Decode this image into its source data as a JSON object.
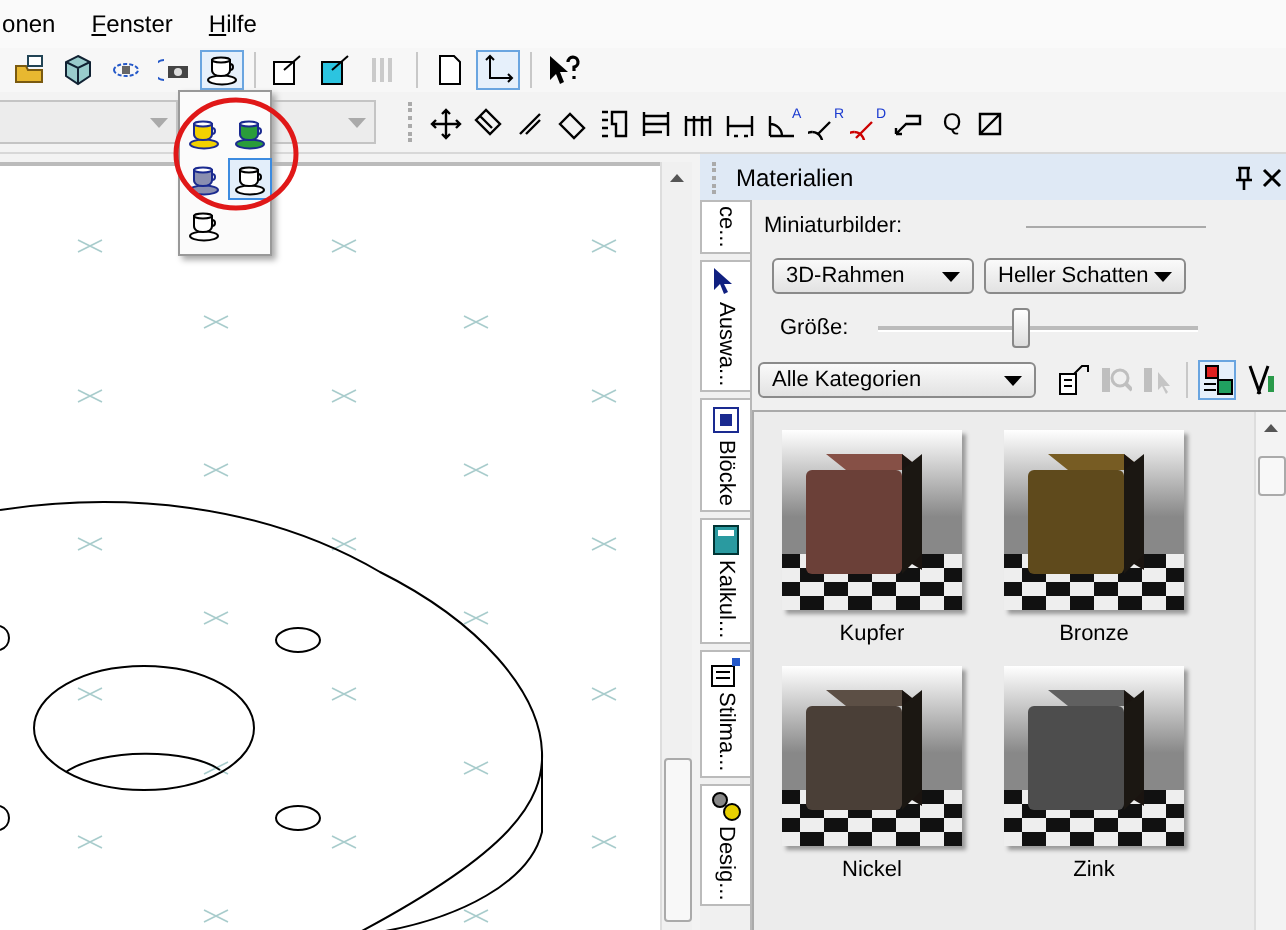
{
  "menu": [
    {
      "label": "onen",
      "accelerator": false
    },
    {
      "label": "Fenster",
      "accelerator": true
    },
    {
      "label": "Hilfe",
      "accelerator": true
    }
  ],
  "toolbar": [
    {
      "kind": "open",
      "pressed": false,
      "disabled": false
    },
    {
      "kind": "cube",
      "pressed": false,
      "disabled": false
    },
    {
      "kind": "orbit",
      "pressed": false,
      "disabled": false
    },
    {
      "kind": "camera",
      "pressed": false,
      "disabled": false
    },
    {
      "kind": "render",
      "pressed": true,
      "disabled": false
    },
    {
      "kind": "separator"
    },
    {
      "kind": "export",
      "pressed": false,
      "disabled": false
    },
    {
      "kind": "export-color",
      "pressed": false,
      "disabled": false
    },
    {
      "kind": "bars",
      "pressed": false,
      "disabled": true
    },
    {
      "kind": "separator"
    },
    {
      "kind": "page",
      "pressed": false,
      "disabled": false
    },
    {
      "kind": "axes",
      "pressed": true,
      "disabled": false
    },
    {
      "kind": "separator"
    },
    {
      "kind": "help",
      "pressed": false,
      "disabled": false
    }
  ],
  "combo_boxes": [
    {
      "disabled": true
    },
    {
      "disabled": true
    }
  ],
  "dimension_tools": [
    {
      "kind": "move"
    },
    {
      "kind": "aligned"
    },
    {
      "kind": "slant"
    },
    {
      "kind": "rotated"
    },
    {
      "kind": "ordinate"
    },
    {
      "kind": "baseline"
    },
    {
      "kind": "continuous"
    },
    {
      "kind": "chain"
    },
    {
      "kind": "angle",
      "mark": "A"
    },
    {
      "kind": "radius",
      "mark": "R"
    },
    {
      "kind": "diameter",
      "mark": "D"
    },
    {
      "kind": "leader"
    },
    {
      "kind": "letter",
      "mark": "Q"
    },
    {
      "kind": "datum"
    }
  ],
  "render_menu": [
    {
      "kind": "gold",
      "selected": false
    },
    {
      "kind": "rainbow",
      "selected": false
    },
    {
      "kind": "grey",
      "selected": false
    },
    {
      "kind": "outline",
      "selected": true
    },
    {
      "kind": "outline",
      "selected": false
    }
  ],
  "panel": {
    "title": "Materialien",
    "tabs": [
      {
        "label": "ce...",
        "kind": "none"
      },
      {
        "label": "Auswa...",
        "kind": "select"
      },
      {
        "label": "Blöcke",
        "kind": "blocks"
      },
      {
        "label": "Kalkul...",
        "kind": "calculator"
      },
      {
        "label": "Stilma...",
        "kind": "styles"
      },
      {
        "label": "Desig...",
        "kind": "design"
      }
    ],
    "thumbnails_label": "Miniaturbilder:",
    "frame_select": "3D-Rahmen",
    "shadow_select": "Heller Schatten",
    "size_label": "Größe:",
    "size_slider": {
      "level": 0.44
    },
    "category_select": "Alle Kategorien",
    "category_tools": [
      {
        "kind": "properties",
        "disabled": false,
        "pressed": false
      },
      {
        "kind": "find",
        "disabled": true,
        "pressed": false
      },
      {
        "kind": "pick",
        "disabled": true,
        "pressed": false
      },
      {
        "kind": "view",
        "disabled": false,
        "pressed": true
      },
      {
        "kind": "tools",
        "disabled": false,
        "pressed": false
      }
    ],
    "materials": [
      {
        "name": "Kupfer",
        "color": "#6b4038"
      },
      {
        "name": "Bronze",
        "color": "#5f4a1c"
      },
      {
        "name": "Nickel",
        "color": "#4a3f37"
      },
      {
        "name": "Zink",
        "color": "#4d4d4d"
      }
    ]
  }
}
